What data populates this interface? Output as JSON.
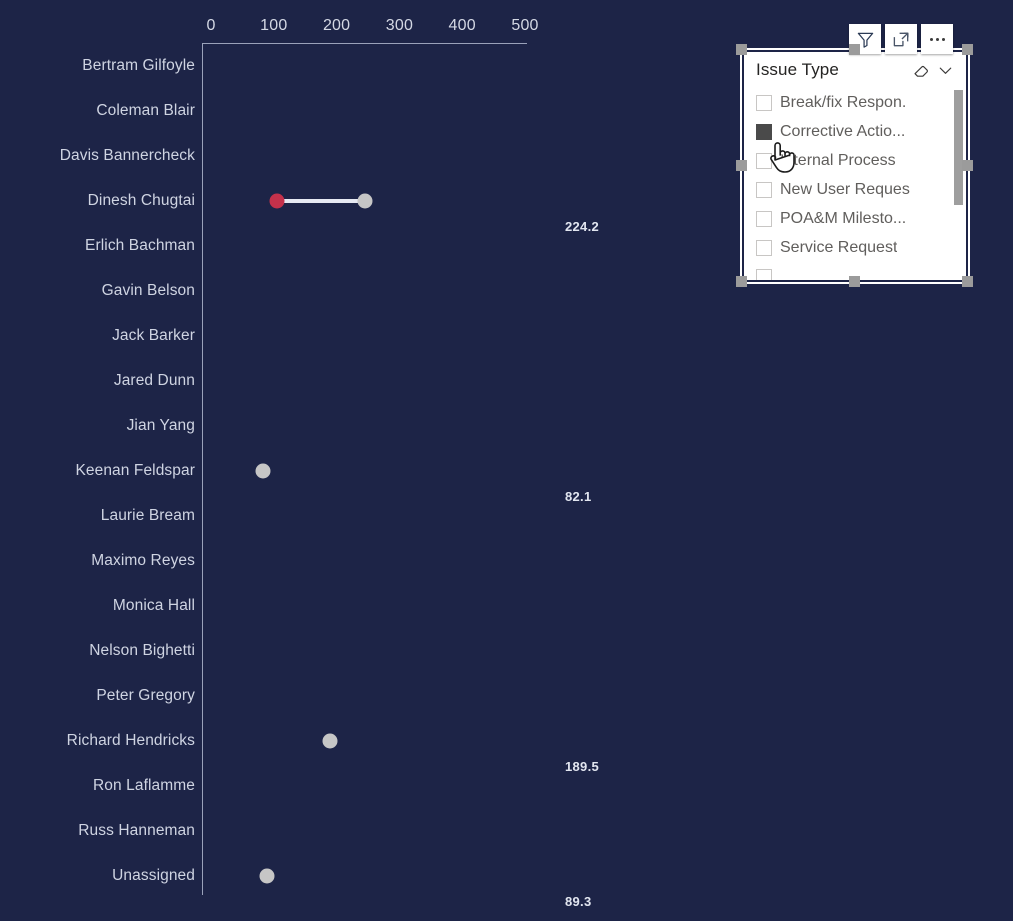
{
  "visual_header": {
    "buttons": [
      {
        "name": "filter-icon",
        "label": "Filters"
      },
      {
        "name": "focus-mode-icon",
        "label": "Focus mode"
      },
      {
        "name": "more-options-icon",
        "label": "More options"
      }
    ]
  },
  "slicer": {
    "title": "Issue Type",
    "clear_icon": "eraser-icon",
    "expand_icon": "chevron-down-icon",
    "items": [
      {
        "label": "Break/fix Respon.",
        "checked": false,
        "pressed": false
      },
      {
        "label": "Corrective Actio...",
        "checked": false,
        "pressed": true
      },
      {
        "label": "Internal Process",
        "checked": false,
        "pressed": false
      },
      {
        "label": "New User Reques",
        "checked": false,
        "pressed": false
      },
      {
        "label": "POA&M Milesto...",
        "checked": false,
        "pressed": false
      },
      {
        "label": "Service Request",
        "checked": false,
        "pressed": false
      }
    ],
    "scrollbar": {
      "visible": true
    }
  },
  "chart_data": {
    "type": "scatter",
    "subtype": "dumbbell",
    "title": "",
    "xlabel": "",
    "ylabel": "",
    "xlim": [
      0,
      500
    ],
    "x_ticks": [
      0,
      100,
      200,
      300,
      400,
      500
    ],
    "x_tick_labels": [
      "0",
      "100",
      "200",
      "300",
      "400",
      "500"
    ],
    "grid": false,
    "legend": "none",
    "categories": [
      "Bertram Gilfoyle",
      "Coleman Blair",
      "Davis Bannercheck",
      "Dinesh Chugtai",
      "Erlich Bachman",
      "Gavin Belson",
      "Jack Barker",
      "Jared Dunn",
      "Jian Yang",
      "Keenan Feldspar",
      "Laurie Bream",
      "Maximo Reyes",
      "Monica Hall",
      "Nelson Bighetti",
      "Peter Gregory",
      "Richard Hendricks",
      "Ron Laflamme",
      "Russ Hanneman",
      "Unassigned"
    ],
    "points": [
      {
        "category": "Bertram Gilfoyle",
        "grey": null,
        "red": null,
        "value_label": null
      },
      {
        "category": "Coleman Blair",
        "grey": null,
        "red": null,
        "value_label": null
      },
      {
        "category": "Davis Bannercheck",
        "grey": null,
        "red": null,
        "value_label": null
      },
      {
        "category": "Dinesh Chugtai",
        "grey": 246.0,
        "red": 105.0,
        "value_label": "224.2"
      },
      {
        "category": "Erlich Bachman",
        "grey": null,
        "red": null,
        "value_label": null
      },
      {
        "category": "Gavin Belson",
        "grey": null,
        "red": null,
        "value_label": null
      },
      {
        "category": "Jack Barker",
        "grey": null,
        "red": null,
        "value_label": null
      },
      {
        "category": "Jared Dunn",
        "grey": null,
        "red": null,
        "value_label": null
      },
      {
        "category": "Jian Yang",
        "grey": null,
        "red": null,
        "value_label": null
      },
      {
        "category": "Keenan Feldspar",
        "grey": 82.1,
        "red": null,
        "value_label": "82.1"
      },
      {
        "category": "Laurie Bream",
        "grey": null,
        "red": null,
        "value_label": null
      },
      {
        "category": "Maximo Reyes",
        "grey": null,
        "red": null,
        "value_label": null
      },
      {
        "category": "Monica Hall",
        "grey": null,
        "red": null,
        "value_label": null
      },
      {
        "category": "Nelson Bighetti",
        "grey": null,
        "red": null,
        "value_label": null
      },
      {
        "category": "Peter Gregory",
        "grey": null,
        "red": null,
        "value_label": null
      },
      {
        "category": "Richard Hendricks",
        "grey": 189.5,
        "red": null,
        "value_label": "189.5"
      },
      {
        "category": "Ron Laflamme",
        "grey": null,
        "red": null,
        "value_label": null
      },
      {
        "category": "Russ Hanneman",
        "grey": null,
        "red": null,
        "value_label": null
      },
      {
        "category": "Unassigned",
        "grey": 89.3,
        "red": null,
        "value_label": "89.3"
      }
    ]
  },
  "colors": {
    "background": "#1d2447",
    "axis_line": "#9aa2ba",
    "category_text": "#cfd4e2",
    "tick_text": "#d4d8e4",
    "value_text": "#e2e6f0",
    "dot_grey": "#c6c6c6",
    "dot_red": "#c4314b",
    "connector": "#e6e9f2",
    "slicer_bg": "#ffffff",
    "slicer_title_text": "#252423",
    "slicer_item_text": "#605e5c",
    "checkbox_pressed": "#4a4a4a",
    "scrollbar_thumb": "#9e9e9e",
    "selection_handle": "#9b9b9b"
  }
}
